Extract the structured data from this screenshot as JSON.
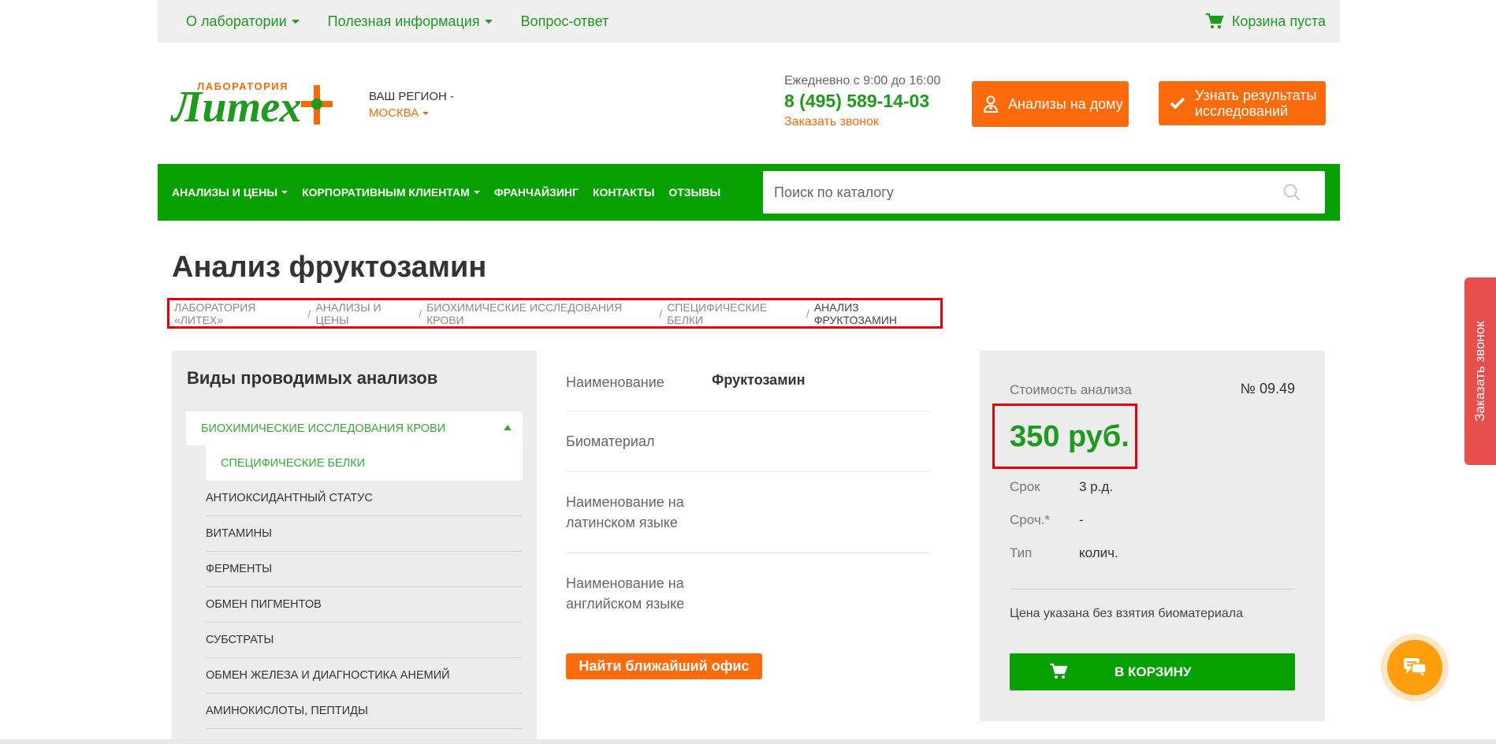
{
  "topbar": {
    "nav": [
      {
        "label": "О лаборатории",
        "dropdown": true
      },
      {
        "label": "Полезная информация",
        "dropdown": true
      },
      {
        "label": "Вопрос-ответ",
        "dropdown": false
      }
    ],
    "cart_label": "Корзина пуста"
  },
  "header": {
    "logo_small": "ЛАБОРАТОРИЯ",
    "logo_big": "Литех",
    "region_label": "ВАШ РЕГИОН -",
    "region_city": "МОСКВА",
    "hours": "Ежедневно с 9:00 до 16:00",
    "phone": "8 (495) 589-14-03",
    "callback": "Заказать звонок",
    "btn_home": "Анализы на дому",
    "btn_results_1": "Узнать результаты",
    "btn_results_2": "исследований"
  },
  "mainnav": {
    "items": [
      {
        "label": "АНАЛИЗЫ И ЦЕНЫ",
        "dropdown": true
      },
      {
        "label": "КОРПОРАТИВНЫМ КЛИЕНТАМ",
        "dropdown": true
      },
      {
        "label": "ФРАНЧАЙЗИНГ",
        "dropdown": false
      },
      {
        "label": "КОНТАКТЫ",
        "dropdown": false
      },
      {
        "label": "ОТЗЫВЫ",
        "dropdown": false
      }
    ],
    "search_placeholder": "Поиск по каталогу"
  },
  "page": {
    "title": "Анализ фруктозамин",
    "breadcrumbs": [
      "ЛАБОРАТОРИЯ «ЛИТЕХ»",
      "АНАЛИЗЫ И ЦЕНЫ",
      "БИОХИМИЧЕСКИЕ ИССЛЕДОВАНИЯ КРОВИ",
      "СПЕЦИФИЧЕСКИЕ БЕЛКИ",
      "АНАЛИЗ ФРУКТОЗАМИН"
    ]
  },
  "sidebar": {
    "heading": "Виды проводимых анализов",
    "category": "БИОХИМИЧЕСКИЕ ИССЛЕДОВАНИЯ КРОВИ",
    "active_item": "СПЕЦИФИЧЕСКИЕ БЕЛКИ",
    "items": [
      "АНТИОКСИДАНТНЫЙ СТАТУС",
      "ВИТАМИНЫ",
      "ФЕРМЕНТЫ",
      "ОБМЕН ПИГМЕНТОВ",
      "СУБСТРАТЫ",
      "ОБМЕН ЖЕЛЕЗА И ДИАГНОСТИКА АНЕМИЙ",
      "АМИНОКИСЛОТЫ, ПЕПТИДЫ"
    ]
  },
  "details": {
    "rows": [
      {
        "label": "Наименование",
        "value": "Фруктозамин"
      },
      {
        "label": "Биоматериал",
        "value": ""
      },
      {
        "label": "Наименование на латинском языке",
        "value": ""
      },
      {
        "label": "Наименование на английском языке",
        "value": ""
      }
    ],
    "office_button": "Найти ближайший офис"
  },
  "price": {
    "label": "Стоимость анализа",
    "number": "№ 09.49",
    "amount": "350 руб.",
    "rows": [
      {
        "key": "Срок",
        "value": "3 р.д."
      },
      {
        "key": "Сроч.*",
        "value": "-"
      },
      {
        "key": "Тип",
        "value": "колич."
      }
    ],
    "note": "Цена указана без взятия биоматериала",
    "cart_button": "В КОРЗИНУ"
  },
  "sidetab": {
    "label": "Заказать звонок"
  },
  "colors": {
    "green": "#06a000",
    "orange": "#fb6a0b",
    "red": "#e3000f"
  }
}
